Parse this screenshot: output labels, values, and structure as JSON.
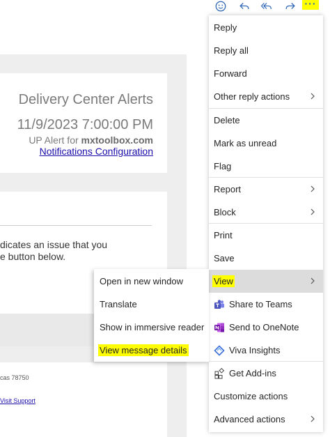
{
  "toolbar": {
    "icons": [
      "emoji-icon",
      "reply-icon",
      "reply-all-icon",
      "forward-icon",
      "more-options-icon"
    ],
    "more_label": "···",
    "highlight_color": "#ffff00",
    "icon_color": "#2b63b5"
  },
  "email": {
    "title": "Delivery Center Alerts",
    "date": "11/9/2023 7:00:00 PM",
    "alert_prefix": "UP Alert for ",
    "alert_domain": "mxtoolbox.com",
    "notifications_link": "Notifications Configuration",
    "body_line1": "dicates an issue that you",
    "body_line2": "e button below.",
    "footer_address": "cas 78750",
    "footer_link": "Visit Support"
  },
  "menu": {
    "reply": "Reply",
    "reply_all": "Reply all",
    "forward": "Forward",
    "other_reply_actions": "Other reply actions",
    "delete": "Delete",
    "mark_unread": "Mark as unread",
    "flag": "Flag",
    "report": "Report",
    "block": "Block",
    "print": "Print",
    "save": "Save",
    "view": "View",
    "share_teams": "Share to Teams",
    "send_onenote": "Send to OneNote",
    "viva_insights": "Viva Insights",
    "get_addins": "Get Add-ins",
    "customize_actions": "Customize actions",
    "advanced_actions": "Advanced actions"
  },
  "submenu": {
    "open_new_window": "Open in new window",
    "translate": "Translate",
    "immersive_reader": "Show in immersive reader",
    "view_message_details": "View message details"
  },
  "colors": {
    "teams": "#5059c9",
    "onenote": "#7719aa",
    "viva": "#3a6fd8",
    "link": "#1a0dab"
  }
}
